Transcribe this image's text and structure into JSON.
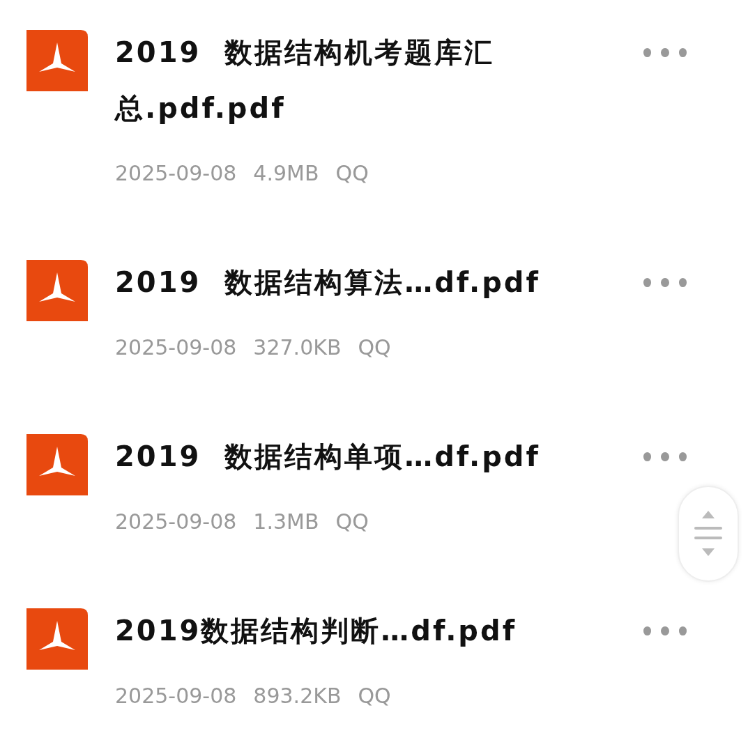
{
  "files": [
    {
      "title": "2019  数据结构机考题库汇总.pdf.pdf",
      "date": "2025-09-08",
      "size": "4.9MB",
      "source": "QQ"
    },
    {
      "title": "2019  数据结构算法…df.pdf",
      "date": "2025-09-08",
      "size": "327.0KB",
      "source": "QQ"
    },
    {
      "title": "2019  数据结构单项…df.pdf",
      "date": "2025-09-08",
      "size": "1.3MB",
      "source": "QQ"
    },
    {
      "title": "2019数据结构判断…df.pdf",
      "date": "2025-09-08",
      "size": "893.2KB",
      "source": "QQ"
    }
  ]
}
